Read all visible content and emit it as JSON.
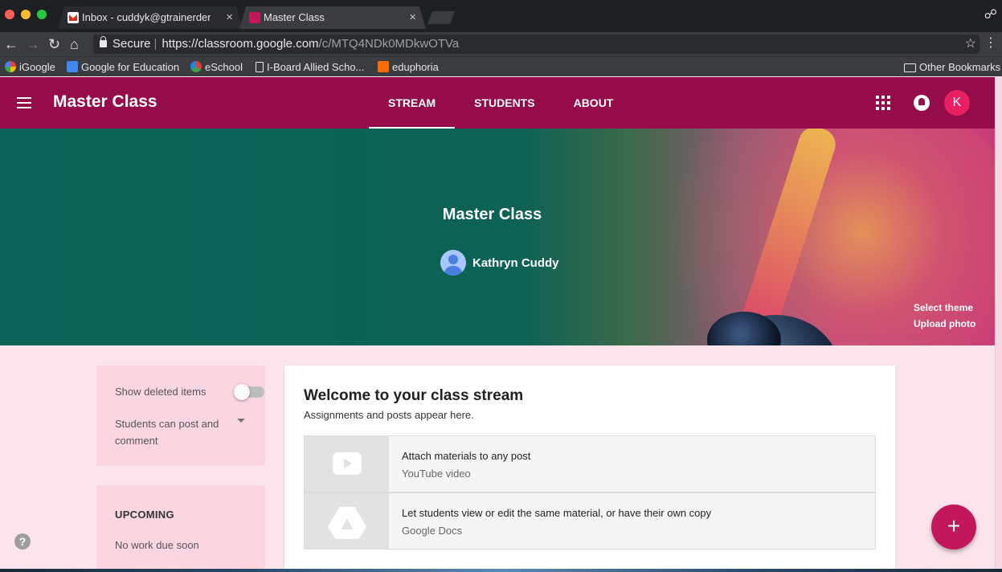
{
  "browser": {
    "tabs": [
      {
        "label": "Inbox - cuddyk@gtrainerdemo",
        "close": "×"
      },
      {
        "label": "Master Class",
        "close": "×"
      }
    ],
    "nav": {
      "back": "←",
      "forward": "→",
      "reload": "↻",
      "home": "⌂"
    },
    "address": {
      "secure_label": "Secure",
      "url_host": "https://classroom.google.com",
      "url_path": "/c/MTQ4NDk0MDkwOTVa"
    },
    "bookmarks": [
      {
        "label": "iGoogle",
        "icon": "google-icon"
      },
      {
        "label": "Google for Education",
        "icon": "google-education-icon"
      },
      {
        "label": "eSchool",
        "icon": "eschool-icon"
      },
      {
        "label": "I-Board Allied Scho...",
        "icon": "page-icon"
      },
      {
        "label": "eduphoria",
        "icon": "eduphoria-icon"
      }
    ],
    "other_bookmarks": "Other Bookmarks"
  },
  "app": {
    "title": "Master Class",
    "tabs": [
      {
        "label": "STREAM",
        "active": true
      },
      {
        "label": "STUDENTS",
        "active": false
      },
      {
        "label": "ABOUT",
        "active": false
      }
    ],
    "account_initial": "K",
    "accent_color": "#950c4a"
  },
  "banner": {
    "class_name": "Master Class",
    "teacher": "Kathryn Cuddy",
    "select_theme": "Select theme",
    "upload_photo": "Upload photo"
  },
  "sidebar": {
    "show_deleted": "Show deleted items",
    "show_deleted_on": false,
    "permission": "Students can post and comment",
    "upcoming_title": "UPCOMING",
    "upcoming_empty": "No work due soon"
  },
  "stream": {
    "title": "Welcome to your class stream",
    "subtitle": "Assignments and posts appear here.",
    "tips": [
      {
        "title": "Attach materials to any post",
        "subtitle": "YouTube video",
        "icon": "youtube-icon"
      },
      {
        "title": "Let students view or edit the same material, or have their own copy",
        "subtitle": "Google Docs",
        "icon": "google-drive-icon"
      }
    ]
  },
  "help_label": "?",
  "fab_label": "+"
}
